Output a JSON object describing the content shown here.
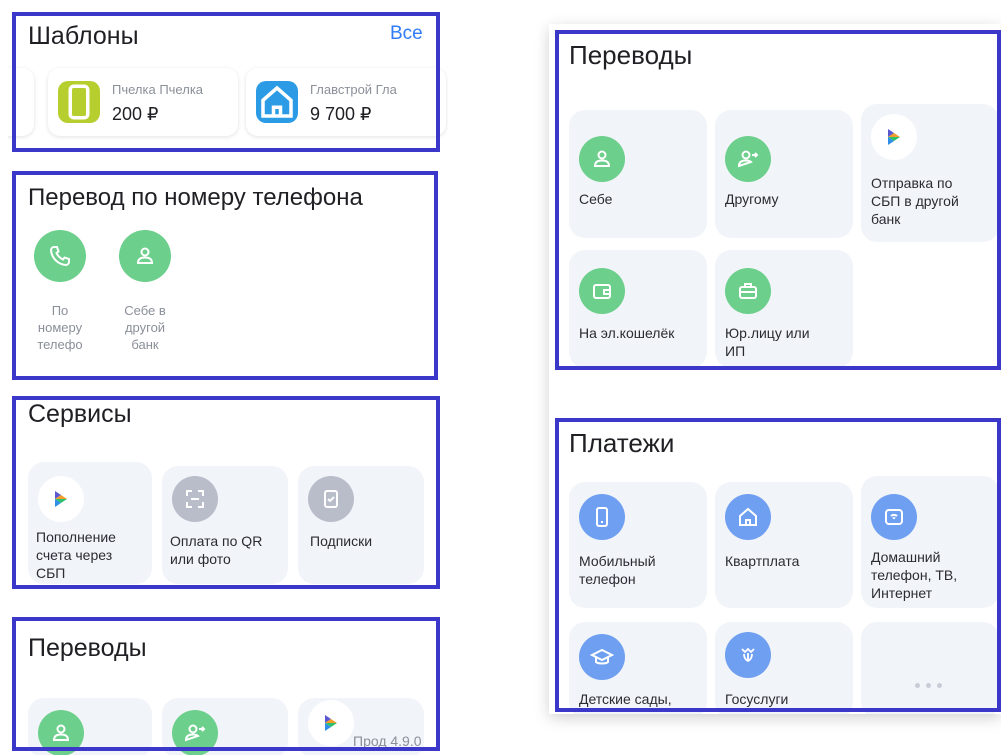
{
  "left": {
    "templates": {
      "title": "Шаблоны",
      "all_link": "Все",
      "items": [
        {
          "name": "Пчелка Пчелка",
          "amount": "200 ₽",
          "icon": "phone-icon",
          "color": "#b7cf2e"
        },
        {
          "name": "Главстрой Гла",
          "amount": "9 700 ₽",
          "icon": "house-icon",
          "color": "#2b9be6"
        }
      ]
    },
    "phone_transfer": {
      "title": "Перевод по номеру телефона",
      "items": [
        {
          "label": "По\nномеру\nтелефо",
          "icon": "handset-icon"
        },
        {
          "label": "Себе в\nдругой\nбанк",
          "icon": "person-icon"
        }
      ]
    },
    "services": {
      "title": "Сервисы",
      "items": [
        {
          "label": "Пополнение\nсчета через\nСБП",
          "icon": "sbp-icon"
        },
        {
          "label": "Оплата по QR\nили фото",
          "icon": "qr-scan-icon"
        },
        {
          "label": "Подписки",
          "icon": "subscription-icon"
        }
      ]
    },
    "transfers_peek": {
      "title": "Переводы",
      "version": "Прод 4.9.0"
    }
  },
  "right": {
    "transfers": {
      "title": "Переводы",
      "items": [
        {
          "label": "Себе",
          "icon": "person-icon"
        },
        {
          "label": "Другому",
          "icon": "person-arrow-icon"
        },
        {
          "label": "Отправка по\nСБП в другой\nбанк",
          "icon": "sbp-icon"
        },
        {
          "label": "На эл.кошелёк",
          "icon": "wallet-icon"
        },
        {
          "label": "Юр.лицу или\nИП",
          "icon": "briefcase-icon"
        }
      ]
    },
    "payments": {
      "title": "Платежи",
      "items": [
        {
          "label": "Мобильный\nтелефон",
          "icon": "mobile-icon"
        },
        {
          "label": "Квартплата",
          "icon": "house-icon"
        },
        {
          "label": "Домашний\nтелефон, ТВ,\nИнтернет",
          "icon": "router-icon"
        },
        {
          "label": "Детские сады,",
          "icon": "graduation-cap-icon"
        },
        {
          "label": "Госуслуги",
          "icon": "emblem-icon"
        }
      ]
    }
  },
  "colors": {
    "highlight": "#3a37c9",
    "green": "#6ccf8b",
    "blue": "#6f9ff0",
    "gray": "#b9bdc9",
    "link": "#2f7cf6",
    "tile": "#f1f4f9"
  }
}
